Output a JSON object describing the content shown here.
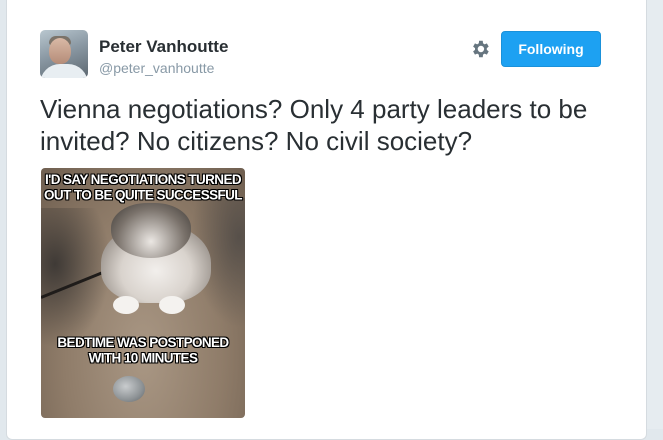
{
  "tweet": {
    "author_name": "Peter Vanhoutte",
    "author_handle": "@peter_vanhoutte",
    "text": "Vienna negotiations? Only 4 party leaders to be invited? No citizens? No civil society?",
    "follow_label": "Following",
    "avatar_icon": "user-avatar",
    "settings_icon": "gear-icon",
    "accent_color": "#1da1f2"
  },
  "media": {
    "top_caption": "I'D SAY NEGOTIATIONS TURNED OUT TO BE QUITE SUCCESSFUL",
    "bottom_caption": "BEDTIME WAS POSTPONED WITH 10 MINUTES"
  }
}
